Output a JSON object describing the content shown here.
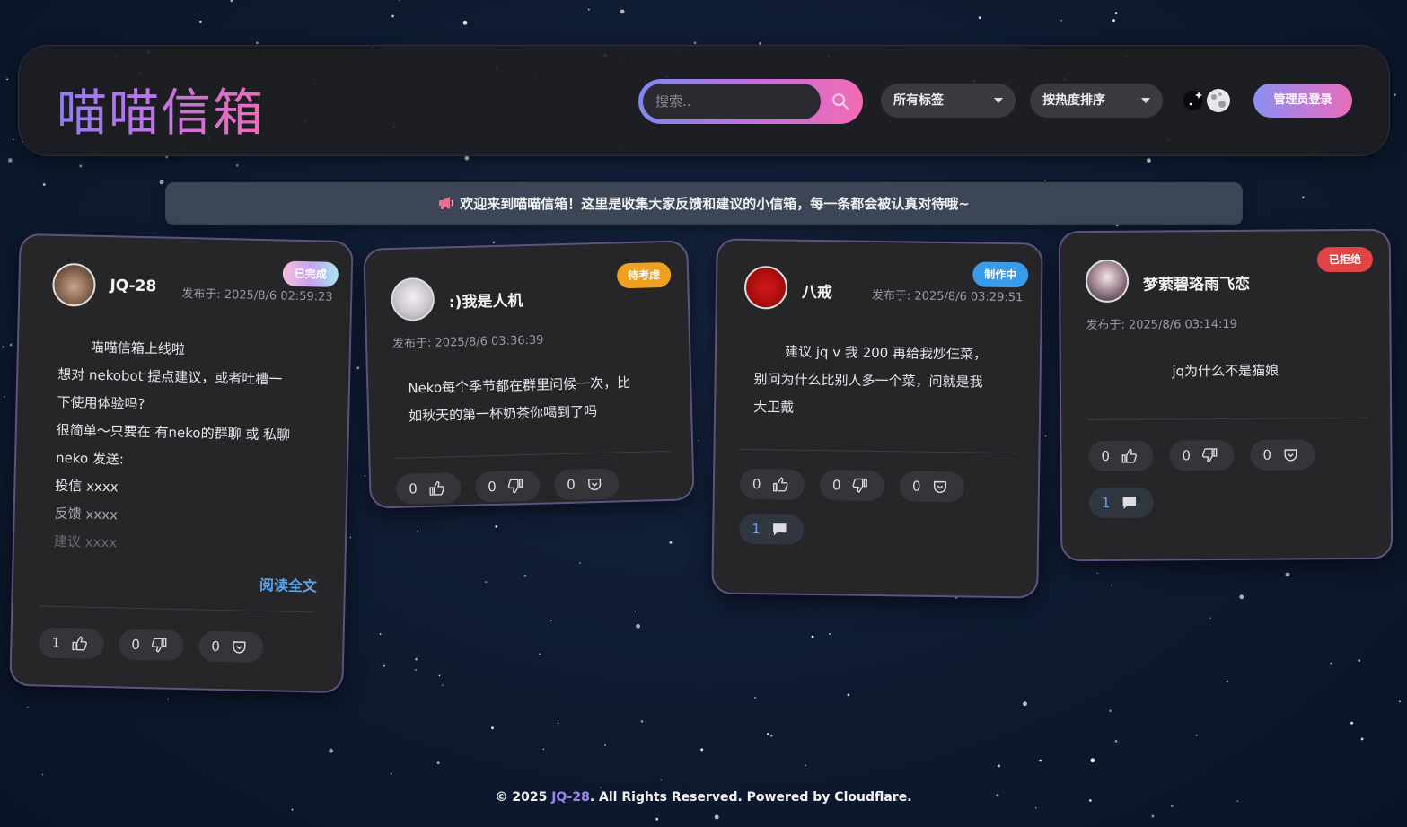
{
  "app": {
    "title": "喵喵信箱"
  },
  "colors": {
    "accent_start": "#8f7df0",
    "accent_end": "#f06bb4",
    "badge_done": "#c9a2f0",
    "badge_pending": "#f0a020",
    "badge_making": "#3a9be8",
    "badge_rejected": "#e04444",
    "comment_blue": "#6aa6e8"
  },
  "header": {
    "search_placeholder": "搜索..",
    "search_icon": "search-icon",
    "tag_filter": "所有标签",
    "sort_filter": "按热度排序",
    "theme_icon": "moon-sun-toggle-icon",
    "admin_label": "管理员登录"
  },
  "notice": {
    "icon": "megaphone-icon",
    "text": "欢迎来到喵喵信箱！这里是收集大家反馈和建议的小信箱，每一条都会被认真对待哦~"
  },
  "cards": [
    {
      "author": "JQ-28",
      "date": "发布于: 2025/8/6 02:59:23",
      "status": "已完成",
      "lines": [
        "喵喵信箱上线啦",
        "想对 nekobot 提点建议，或者吐槽一",
        "下使用体验吗?",
        "很简单～只要在 有neko的群聊 或 私聊",
        "neko 发送:",
        "投信 xxxx",
        "反馈 xxxx",
        "建议 xxxx"
      ],
      "read_more": "阅读全文",
      "likes": "1",
      "dislikes": "0",
      "saves": "0"
    },
    {
      "author": ":)我是人机",
      "date": "发布于: 2025/8/6 03:36:39",
      "status": "待考虑",
      "lines": [
        "Neko每个季节都在群里问候一次，比",
        "如秋天的第一杯奶茶你喝到了吗"
      ],
      "likes": "0",
      "dislikes": "0",
      "saves": "0"
    },
    {
      "author": "八戒",
      "date": "发布于: 2025/8/6 03:29:51",
      "status": "制作中",
      "lines": [
        "建议 jq v 我 200 再给我炒仨菜，",
        "别问为什么比别人多一个菜，问就是我",
        "大卫戴"
      ],
      "likes": "0",
      "dislikes": "0",
      "saves": "0",
      "comments": "1"
    },
    {
      "author": "梦萦碧珞雨飞恋",
      "date": "发布于: 2025/8/6 03:14:19",
      "status": "已拒绝",
      "lines": [
        "jq为什么不是猫娘"
      ],
      "likes": "0",
      "dislikes": "0",
      "saves": "0",
      "comments": "1"
    }
  ],
  "footer": {
    "prefix": "© 2025 ",
    "owner": "JQ-28",
    "suffix": ". All Rights Reserved. Powered by Cloudflare."
  }
}
